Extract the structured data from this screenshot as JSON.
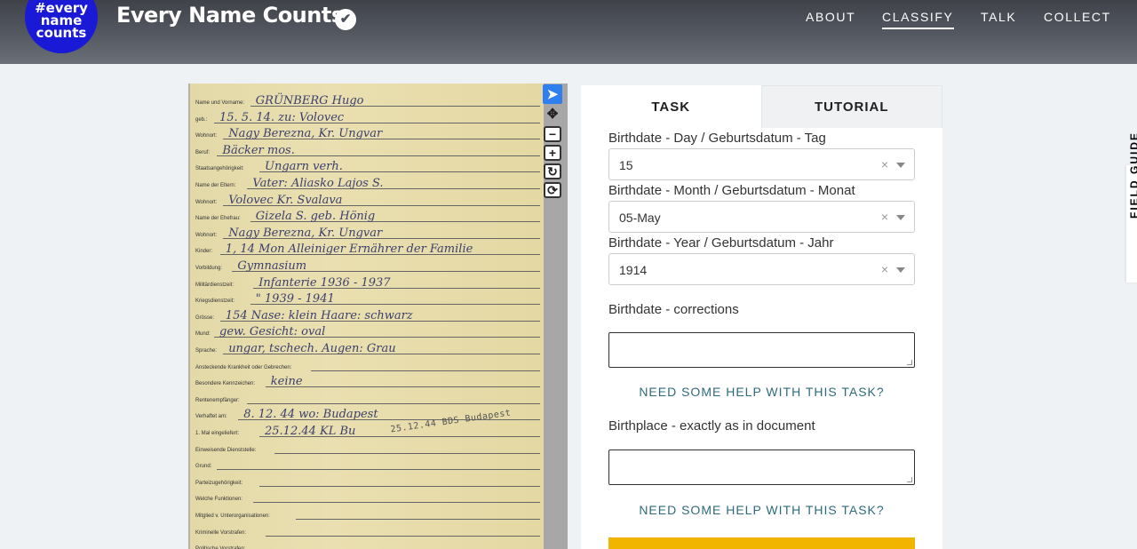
{
  "header": {
    "logo_lines": [
      "#every",
      "name",
      "counts"
    ],
    "site_title": "Every Name Counts",
    "nav": [
      {
        "label": "ABOUT",
        "active": false
      },
      {
        "label": "CLASSIFY",
        "active": true
      },
      {
        "label": "TALK",
        "active": false
      },
      {
        "label": "COLLECT",
        "active": false
      }
    ]
  },
  "document": {
    "rows": [
      {
        "label": "Name und Vorname:",
        "value": "GRÜNBERG  Hugo"
      },
      {
        "label": "geb.:",
        "value": "15. 5. 14.   zu: Volovec"
      },
      {
        "label": "Wohnort:",
        "value": "Nagy Berezna, Kr. Ungvar"
      },
      {
        "label": "Beruf:",
        "value": "Bäcker                    mos."
      },
      {
        "label": "Staatsangehörigkeit:",
        "value": "Ungarn            verh."
      },
      {
        "label": "Name der Eltern:",
        "value": "Vater: Aliasko Lajos S."
      },
      {
        "label": "Wohnort:",
        "value": "Volovec   Kr. Svalava"
      },
      {
        "label": "Name der Ehefrau:",
        "value": "Gizela S. geb. Hönig"
      },
      {
        "label": "Wohnort:",
        "value": "Nagy Berezna, Kr. Ungvar"
      },
      {
        "label": "Kinder:",
        "value": "1, 14 Mon  Alleiniger Ernährer der Familie"
      },
      {
        "label": "Vorbildung:",
        "value": "Gymnasium"
      },
      {
        "label": "Militärdienstzeit:",
        "value": "Infanterie       1936 - 1937"
      },
      {
        "label": "Kriegsdienstzeit:",
        "value": "\"                  1939 - 1941"
      },
      {
        "label": "Grösse:",
        "value": "154    Nase: klein   Haare: schwarz"
      },
      {
        "label": "Mund:",
        "value": "gew.     Gesicht: oval"
      },
      {
        "label": "Sprache:",
        "value": "ungar, tschech.   Augen: Grau"
      },
      {
        "label": "Ansteckende Krankheit oder Gebrechen:",
        "value": ""
      },
      {
        "label": "Besondere Kennzeichen:",
        "value": "keine"
      },
      {
        "label": "Rentenempfänger:",
        "value": ""
      },
      {
        "label": "Verhaftet am:",
        "value": "8. 12. 44   wo: Budapest"
      },
      {
        "label": "1. Mal eingeliefert:",
        "value": "25.12.44 KL Bu"
      },
      {
        "label": "Einweisende Dienststelle:",
        "value": ""
      },
      {
        "label": "Grund:",
        "value": ""
      },
      {
        "label": "Parteizugehörigkeit:",
        "value": ""
      },
      {
        "label": "Welche Funktionen:",
        "value": ""
      },
      {
        "label": "Mitglied v. Unterorganisationen:",
        "value": ""
      },
      {
        "label": "Kriminelle Vorstrafen:",
        "value": ""
      },
      {
        "label": "Politische Vorstrafen:",
        "value": ""
      }
    ],
    "stamp": "25.12.44  BDS Budapest"
  },
  "tools": [
    {
      "name": "pointer-tool",
      "glyph": "➤"
    },
    {
      "name": "pan-tool",
      "glyph": "✥"
    },
    {
      "name": "zoom-out-tool",
      "glyph": "−"
    },
    {
      "name": "zoom-in-tool",
      "glyph": "+"
    },
    {
      "name": "rotate-tool",
      "glyph": "↻"
    },
    {
      "name": "reset-tool",
      "glyph": "⟳"
    }
  ],
  "panel": {
    "tabs": [
      "TASK",
      "TUTORIAL"
    ],
    "fields": {
      "day_label": "Birthdate - Day / Geburtsdatum - Tag",
      "day_value": "15",
      "month_label": "Birthdate - Month / Geburtsdatum - Monat",
      "month_value": "05-May",
      "year_label": "Birthdate - Year / Geburtsdatum - Jahr",
      "year_value": "1914",
      "corrections_label": "Birthdate - corrections",
      "birthplace_label": "Birthplace - exactly as in document",
      "clear_glyph": "×"
    },
    "help_link": "NEED SOME HELP WITH THIS TASK?"
  },
  "field_guide": "FIELD GUIDE"
}
